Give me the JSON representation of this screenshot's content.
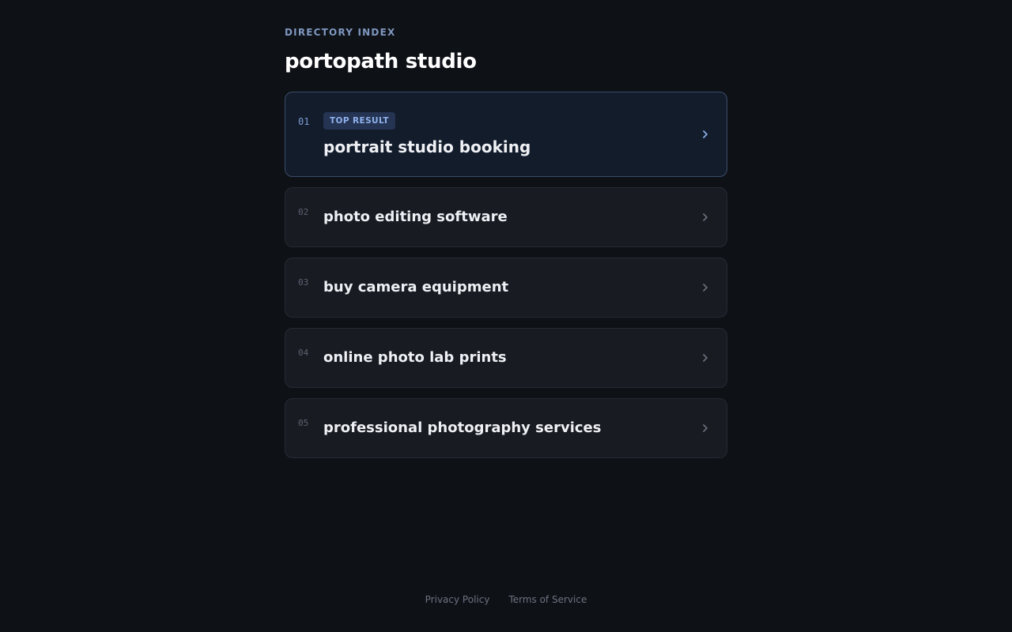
{
  "header": {
    "eyebrow": "DIRECTORY INDEX",
    "title": "portopath studio"
  },
  "results": [
    {
      "number": "01",
      "badge": "TOP RESULT",
      "label": "portrait studio booking"
    },
    {
      "number": "02",
      "label": "photo editing software"
    },
    {
      "number": "03",
      "label": "buy camera equipment"
    },
    {
      "number": "04",
      "label": "online photo lab prints"
    },
    {
      "number": "05",
      "label": "professional photography services"
    }
  ],
  "footer": {
    "privacy": "Privacy Policy",
    "terms": "Terms of Service"
  },
  "colors": {
    "background": "#0e1116",
    "accent": "#7b9bd3",
    "featured_border": "#3a4c6b",
    "badge_bg": "#253452"
  },
  "icons": {
    "chevron": "chevron-right-icon"
  }
}
